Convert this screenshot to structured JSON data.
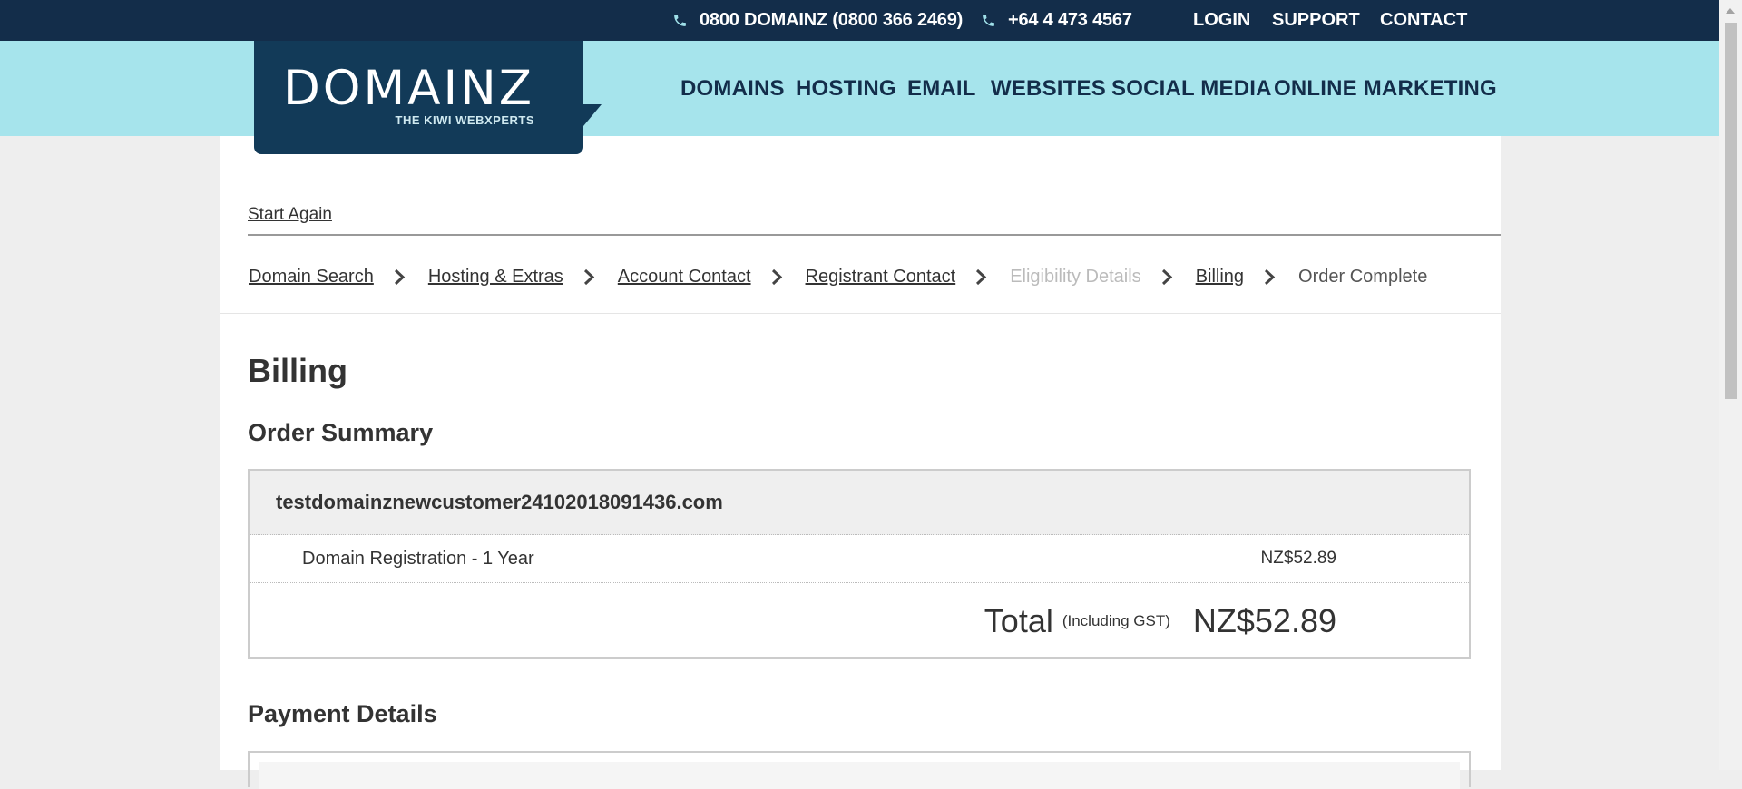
{
  "topbar": {
    "phone1": "0800 DOMAINZ (0800 366 2469)",
    "phone2": "+64 4 473 4567",
    "links": [
      "LOGIN",
      "SUPPORT",
      "CONTACT"
    ]
  },
  "logo": {
    "wordmark": "DOMAINZ",
    "tagline": "THE KIWI WEBXPERTS"
  },
  "nav": [
    "DOMAINS",
    "HOSTING",
    "EMAIL",
    "WEBSITES",
    "SOCIAL MEDIA",
    "ONLINE MARKETING"
  ],
  "start_again": "Start Again",
  "steps": [
    {
      "label": "Domain Search",
      "state": "link"
    },
    {
      "label": "Hosting & Extras",
      "state": "link"
    },
    {
      "label": "Account Contact",
      "state": "link"
    },
    {
      "label": "Registrant Contact",
      "state": "link"
    },
    {
      "label": "Eligibility Details",
      "state": "disabled"
    },
    {
      "label": "Billing",
      "state": "link"
    },
    {
      "label": "Order Complete",
      "state": "current"
    }
  ],
  "page_title": "Billing",
  "order_summary": {
    "heading": "Order Summary",
    "domain": "testdomainznewcustomer24102018091436.com",
    "line_item": "Domain Registration - 1 Year",
    "line_price": "NZ$52.89",
    "total_label": "Total",
    "total_note": "(Including GST)",
    "total_amount": "NZ$52.89"
  },
  "payment_heading": "Payment Details",
  "colors": {
    "topbar": "#132d4a",
    "navbar": "#a6e4ec",
    "logo_bg": "#123a58",
    "icon_phone": "#9fdfe8"
  }
}
